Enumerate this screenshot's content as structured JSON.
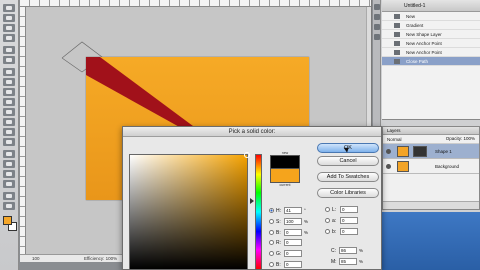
{
  "status_bar": {
    "zoom": "100",
    "doc_info": "Efficiency: 100%"
  },
  "history_panel": {
    "title": "Untitled-1",
    "items": [
      {
        "label": "New"
      },
      {
        "label": "Gradient"
      },
      {
        "label": "New Shape Layer"
      },
      {
        "label": "New Anchor Point"
      },
      {
        "label": "New Anchor Point"
      },
      {
        "label": "Close Path",
        "selected": true
      }
    ]
  },
  "layers_panel": {
    "tab": "Layers",
    "blend_mode": "Normal",
    "opacity_label": "Opacity:",
    "opacity_value": "100%",
    "layers": [
      {
        "name": "Shape 1",
        "selected": true
      },
      {
        "name": "Background"
      }
    ]
  },
  "color_picker": {
    "title": "Pick a solid color:",
    "preview_new_label": "new",
    "preview_current_label": "current",
    "buttons": {
      "ok": "OK",
      "cancel": "Cancel",
      "add_to_swatches": "Add To Swatches",
      "color_libraries": "Color Libraries"
    },
    "fields": {
      "h": {
        "label": "H:",
        "value": "41",
        "unit": "°"
      },
      "s": {
        "label": "S:",
        "value": "100",
        "unit": "%"
      },
      "b": {
        "label": "B:",
        "value": "0",
        "unit": "%"
      },
      "r": {
        "label": "R:",
        "value": "0",
        "unit": ""
      },
      "g": {
        "label": "G:",
        "value": "0",
        "unit": ""
      },
      "bb": {
        "label": "B:",
        "value": "0",
        "unit": ""
      },
      "l": {
        "label": "L:",
        "value": "0",
        "unit": ""
      },
      "a": {
        "label": "a:",
        "value": "0",
        "unit": ""
      },
      "b2": {
        "label": "b:",
        "value": "0",
        "unit": ""
      },
      "c": {
        "label": "C:",
        "value": "86",
        "unit": "%"
      },
      "m": {
        "label": "M:",
        "value": "85",
        "unit": "%"
      }
    }
  },
  "colors": {
    "canvas_orange": "#f6aa26",
    "shape_red": "#a1111a",
    "selected_color": "#000000",
    "current_color": "#f5a41c",
    "ok_button_blue": "#7fb2ec"
  }
}
